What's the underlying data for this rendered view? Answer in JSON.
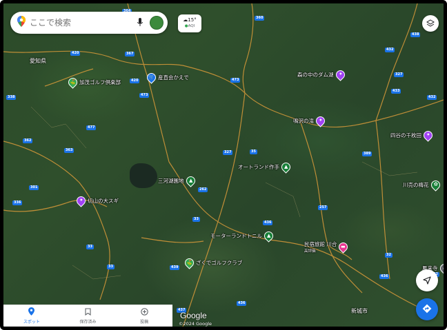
{
  "search": {
    "placeholder": "ここで検索"
  },
  "weather": {
    "temp": "15°",
    "aqi": "AQI"
  },
  "region_label": "愛知県",
  "pois": [
    {
      "label": "加茂ゴルフ倶楽部",
      "icon": "golf-icon",
      "color": "#34a853"
    },
    {
      "label": "産直会かえで",
      "icon": "shopping-cart-icon",
      "color": "#1a73e8"
    },
    {
      "label": "森の中のダム湖",
      "icon": "attraction-icon",
      "color": "#a142f4"
    },
    {
      "label": "鳴沢の滝",
      "icon": "attraction-icon",
      "color": "#a142f4"
    },
    {
      "label": "四谷の千枚田",
      "icon": "attraction-icon",
      "color": "#a142f4"
    },
    {
      "label": "オートランド作手",
      "icon": "park-icon",
      "color": "#188038"
    },
    {
      "label": "三河湖園地",
      "icon": "park-icon",
      "color": "#188038"
    },
    {
      "label": "川売の梅花",
      "icon": "flower-icon",
      "color": "#188038"
    },
    {
      "label": "切山の大スギ",
      "icon": "attraction-icon",
      "color": "#a142f4"
    },
    {
      "label": "モーターランドトニル",
      "icon": "park-icon",
      "color": "#188038"
    },
    {
      "label": "民宿旅館 川合",
      "sublabel": "高評価",
      "icon": "hotel-icon",
      "color": "#e8368f"
    },
    {
      "label": "ざくでゴルフクラブ",
      "icon": "golf-icon",
      "color": "#34a853"
    },
    {
      "label": "鳳来寺",
      "icon": "temple-icon",
      "color": "#5f6368"
    }
  ],
  "city_label": "新城市",
  "route_shields": [
    "364",
    "360",
    "420",
    "367",
    "420",
    "473",
    "473",
    "338",
    "477",
    "362",
    "363",
    "301",
    "336",
    "327",
    "35",
    "262",
    "33",
    "33",
    "33",
    "257",
    "436",
    "389",
    "432",
    "327",
    "433",
    "438",
    "432",
    "32",
    "436",
    "32",
    "436",
    "437",
    "439"
  ],
  "bottom_nav": [
    {
      "label": "スポット",
      "icon": "location-pin-icon",
      "active": true
    },
    {
      "label": "保存済み",
      "icon": "bookmark-icon",
      "active": false
    },
    {
      "label": "投稿",
      "icon": "add-circle-icon",
      "active": false
    }
  ],
  "attribution": {
    "logo": "Google",
    "copyright": "©2024 Google"
  },
  "colors": {
    "accent": "#1a73e8",
    "road": "#d99a3a",
    "shield": "#1a73e8"
  }
}
